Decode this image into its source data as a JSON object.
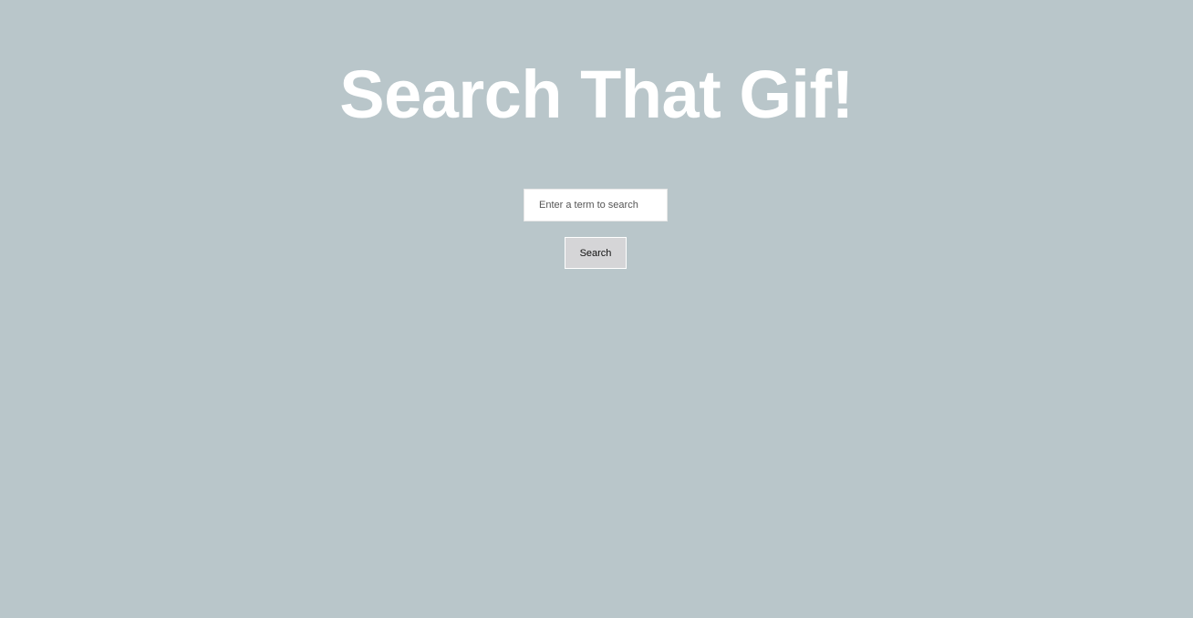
{
  "header": {
    "title": "Search That Gif!"
  },
  "search": {
    "placeholder": "Enter a term to search",
    "value": "",
    "button_label": "Search"
  },
  "colors": {
    "background": "#b9c6ca",
    "title": "#ffffff",
    "button_bg": "#d5d5d7"
  }
}
